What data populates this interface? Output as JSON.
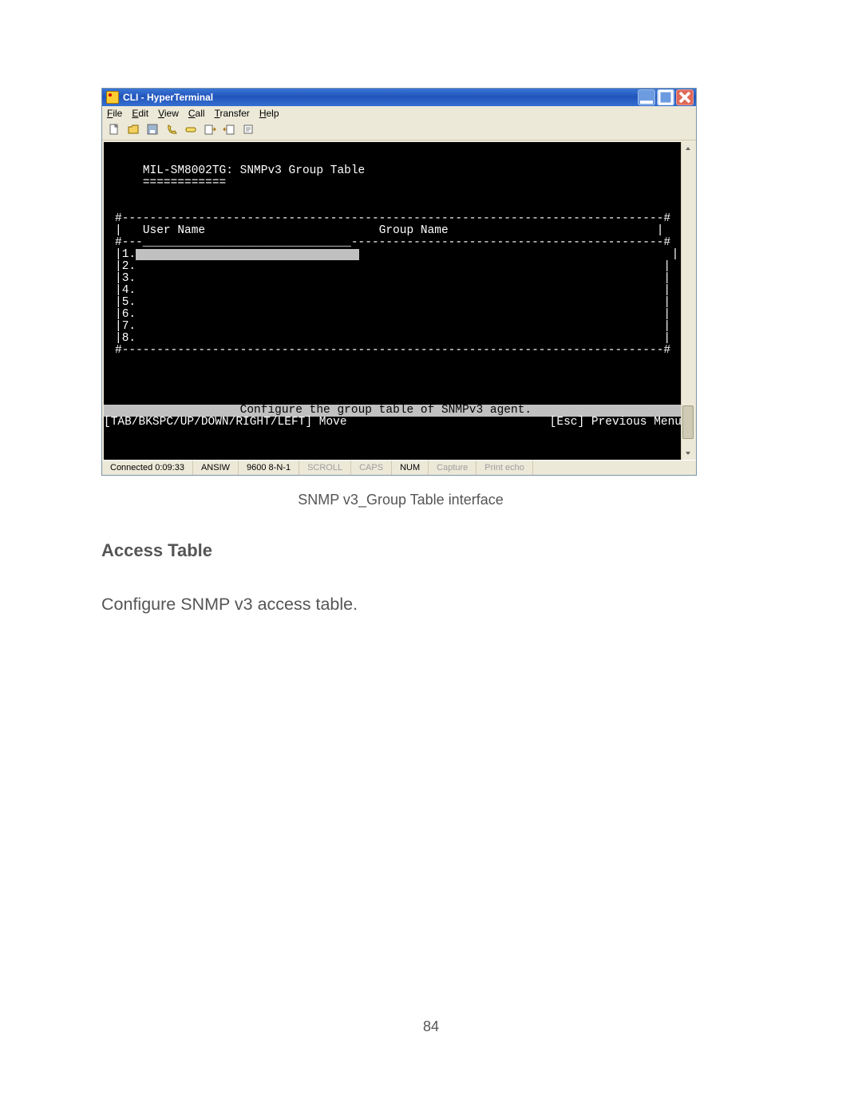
{
  "window": {
    "title": "CLI - HyperTerminal",
    "menus": [
      "File",
      "Edit",
      "View",
      "Call",
      "Transfer",
      "Help"
    ]
  },
  "toolbar_icons": [
    "new-file-icon",
    "open-file-icon",
    "save-icon",
    "call-icon",
    "hangup-icon",
    "send-icon",
    "receive-icon",
    "properties-icon"
  ],
  "terminal": {
    "heading": "MIL-SM8002TG: SNMPv3 Group Table",
    "heading_underline": "============",
    "columns": {
      "user": "User Name",
      "group": "Group Name"
    },
    "rows": [
      "1.",
      "2.",
      "3.",
      "4.",
      "5.",
      "6.",
      "7.",
      "8."
    ],
    "configure_line": "Configure the group table of SNMPv3 agent.",
    "hint_left": "[TAB/BKSPC/UP/DOWN/RIGHT/LEFT] Move",
    "hint_right": "[Esc] Previous Menu"
  },
  "statusbar": {
    "connected": "Connected 0:09:33",
    "emulation": "ANSIW",
    "settings": "9600 8-N-1",
    "scroll": "SCROLL",
    "caps": "CAPS",
    "num": "NUM",
    "capture": "Capture",
    "echo": "Print echo"
  },
  "doc": {
    "caption": "SNMP v3_Group Table interface",
    "heading": "Access Table",
    "paragraph": "Configure SNMP v3 access table.",
    "page_number": "84"
  }
}
